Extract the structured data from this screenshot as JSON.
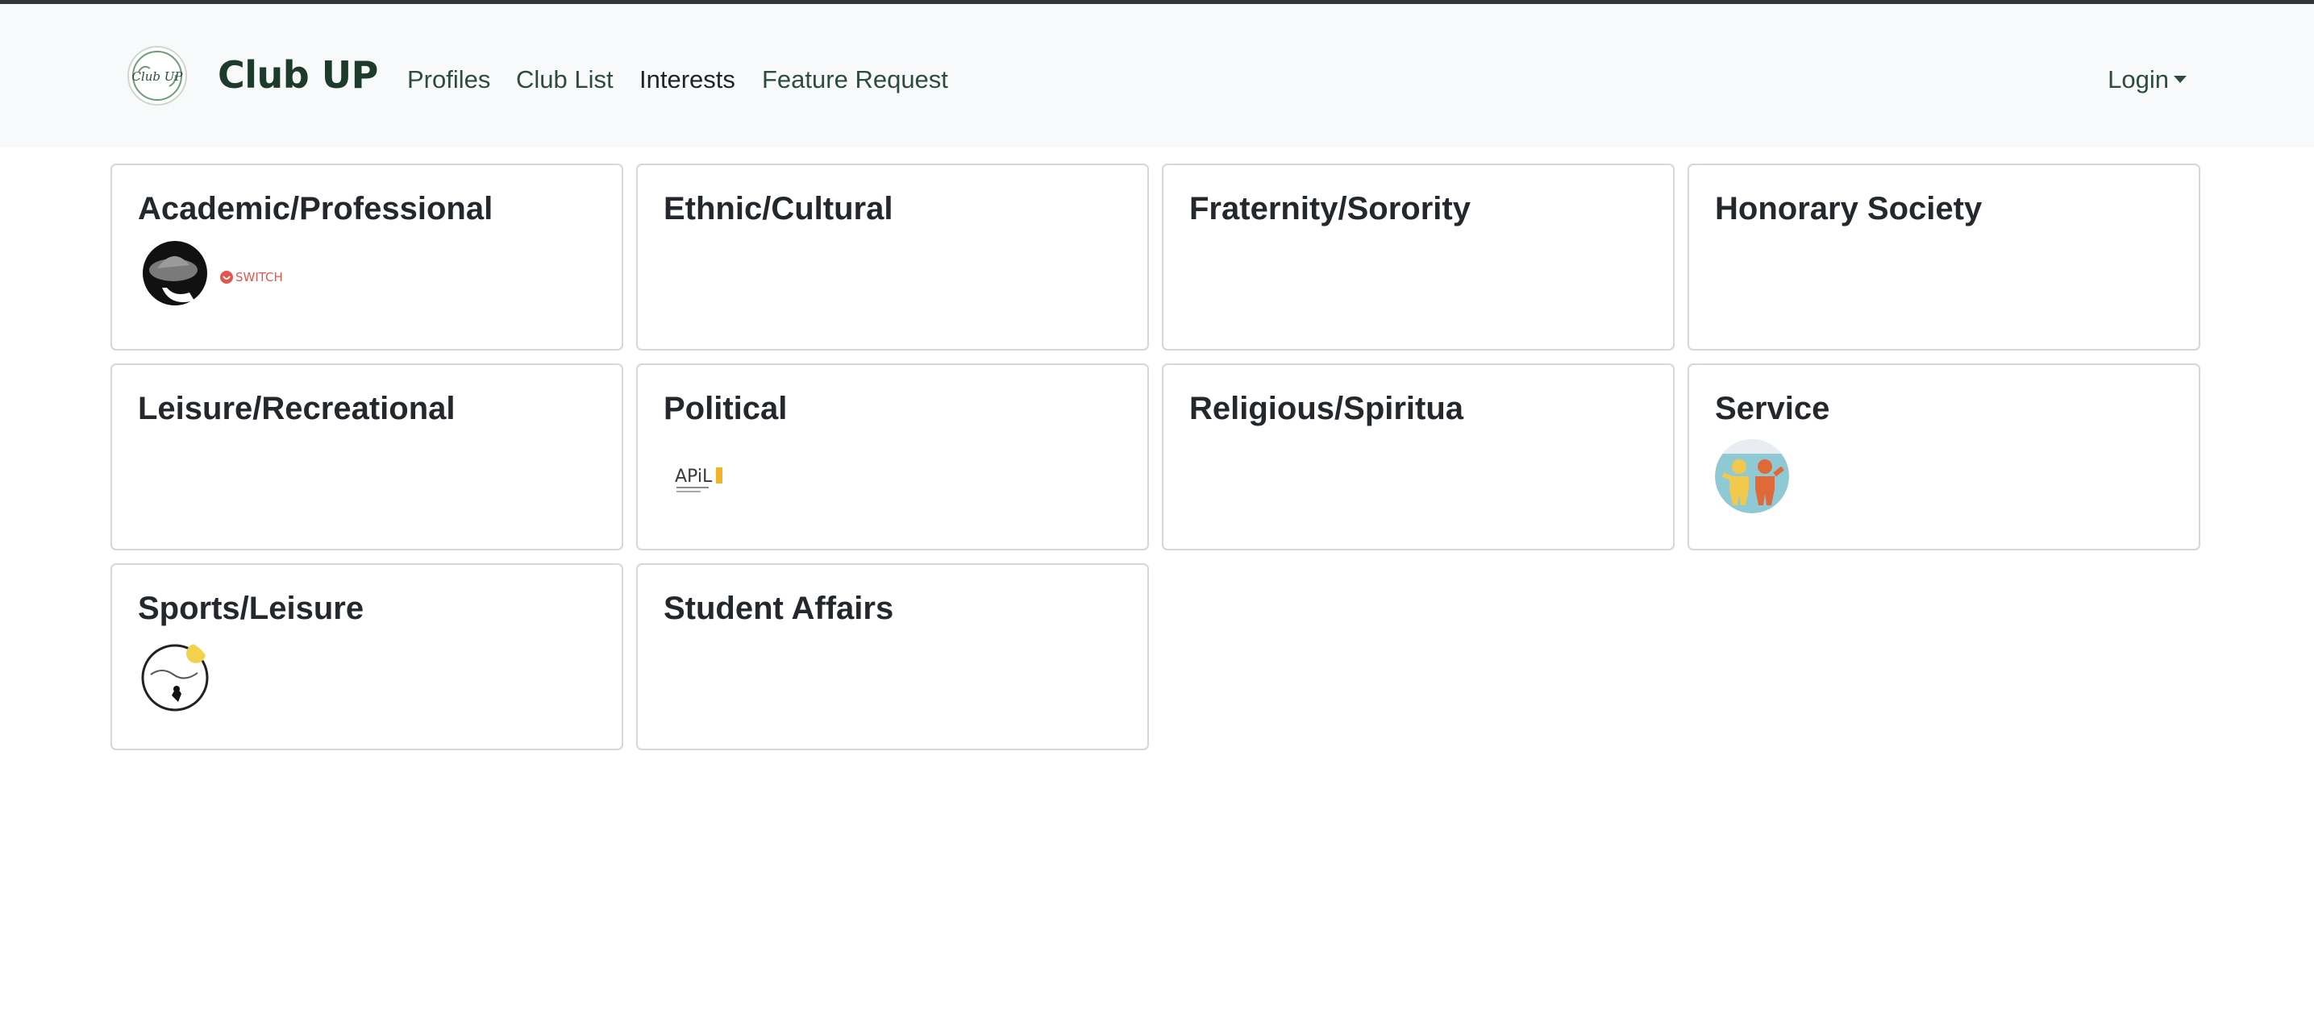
{
  "navbar": {
    "brand": "Club UP",
    "logo_text": "Club UP",
    "links": [
      "Profiles",
      "Club List",
      "Interests",
      "Feature Request"
    ],
    "active_link": "Interests",
    "login_label": "Login"
  },
  "categories": [
    {
      "title": "Academic/Professional",
      "logos": [
        "hat-club-logo",
        "switch-logo"
      ],
      "logo_text": [
        "SWITCH"
      ]
    },
    {
      "title": "Ethnic/Cultural",
      "logos": []
    },
    {
      "title": "Fraternity/Sorority",
      "logos": []
    },
    {
      "title": "Honorary Society",
      "logos": []
    },
    {
      "title": "Leisure/Recreational",
      "logos": []
    },
    {
      "title": "Political",
      "logos": [
        "apil-logo"
      ],
      "logo_text": [
        "APiL"
      ]
    },
    {
      "title": "Religious/Spiritua",
      "logos": []
    },
    {
      "title": "Service",
      "logos": [
        "best-buddies-logo"
      ]
    },
    {
      "title": "Sports/Leisure",
      "logos": [
        "dance-club-logo"
      ]
    },
    {
      "title": "Student Affairs",
      "logos": []
    }
  ],
  "colors": {
    "navbar_bg": "#f8f9fa",
    "brand": "#1d3b2a",
    "link": "#2d4d3c",
    "card_border": "#d5d7da"
  }
}
